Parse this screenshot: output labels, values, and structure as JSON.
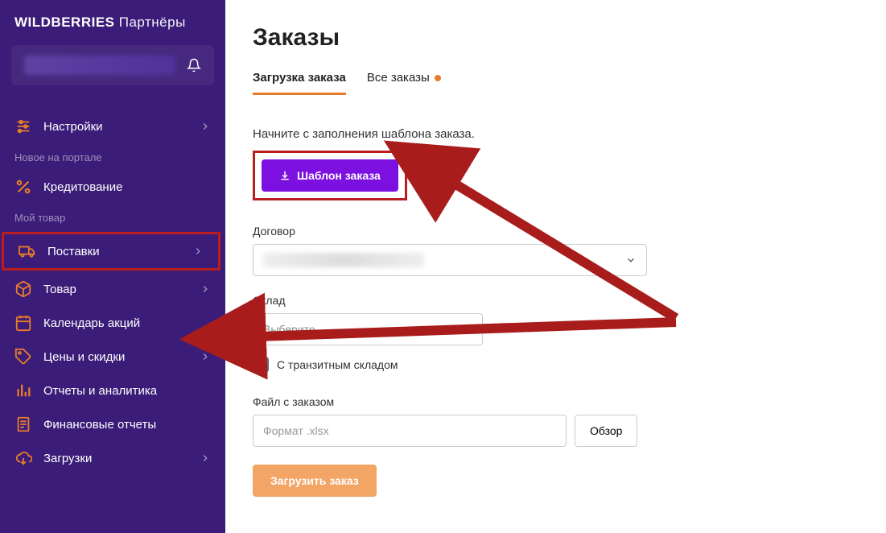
{
  "logo": {
    "brand": "WILDBERRIES",
    "sub": "Партнёры"
  },
  "sidebar": {
    "settings": "Настройки",
    "section_new": "Новое на портале",
    "credit": "Кредитование",
    "section_goods": "Мой товар",
    "deliveries": "Поставки",
    "product": "Товар",
    "calendar": "Календарь акций",
    "prices": "Цены и скидки",
    "reports": "Отчеты и аналитика",
    "finreports": "Финансовые отчеты",
    "downloads": "Загрузки"
  },
  "page": {
    "title": "Заказы",
    "tab_upload": "Загрузка заказа",
    "tab_all": "Все заказы",
    "lead": "Начните с заполнения шаблона заказа.",
    "template_btn": "Шаблон заказа",
    "contract_label": "Договор",
    "warehouse_label": "Склад",
    "warehouse_placeholder": "Выберите",
    "transit_label": "С транзитным складом",
    "file_label": "Файл с заказом",
    "file_placeholder": "Формат .xlsx",
    "browse_btn": "Обзор",
    "upload_btn": "Загрузить заказ"
  }
}
